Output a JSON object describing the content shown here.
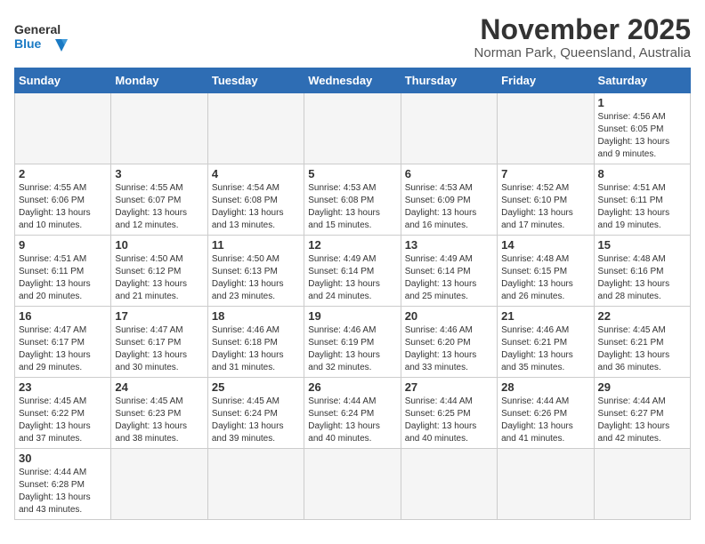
{
  "header": {
    "title": "November 2025",
    "subtitle": "Norman Park, Queensland, Australia",
    "logo_general": "General",
    "logo_blue": "Blue"
  },
  "days_of_week": [
    "Sunday",
    "Monday",
    "Tuesday",
    "Wednesday",
    "Thursday",
    "Friday",
    "Saturday"
  ],
  "weeks": [
    [
      {
        "day": "",
        "info": ""
      },
      {
        "day": "",
        "info": ""
      },
      {
        "day": "",
        "info": ""
      },
      {
        "day": "",
        "info": ""
      },
      {
        "day": "",
        "info": ""
      },
      {
        "day": "",
        "info": ""
      },
      {
        "day": "1",
        "info": "Sunrise: 4:56 AM\nSunset: 6:05 PM\nDaylight: 13 hours and 9 minutes."
      }
    ],
    [
      {
        "day": "2",
        "info": "Sunrise: 4:55 AM\nSunset: 6:06 PM\nDaylight: 13 hours and 10 minutes."
      },
      {
        "day": "3",
        "info": "Sunrise: 4:55 AM\nSunset: 6:07 PM\nDaylight: 13 hours and 12 minutes."
      },
      {
        "day": "4",
        "info": "Sunrise: 4:54 AM\nSunset: 6:08 PM\nDaylight: 13 hours and 13 minutes."
      },
      {
        "day": "5",
        "info": "Sunrise: 4:53 AM\nSunset: 6:08 PM\nDaylight: 13 hours and 15 minutes."
      },
      {
        "day": "6",
        "info": "Sunrise: 4:53 AM\nSunset: 6:09 PM\nDaylight: 13 hours and 16 minutes."
      },
      {
        "day": "7",
        "info": "Sunrise: 4:52 AM\nSunset: 6:10 PM\nDaylight: 13 hours and 17 minutes."
      },
      {
        "day": "8",
        "info": "Sunrise: 4:51 AM\nSunset: 6:11 PM\nDaylight: 13 hours and 19 minutes."
      }
    ],
    [
      {
        "day": "9",
        "info": "Sunrise: 4:51 AM\nSunset: 6:11 PM\nDaylight: 13 hours and 20 minutes."
      },
      {
        "day": "10",
        "info": "Sunrise: 4:50 AM\nSunset: 6:12 PM\nDaylight: 13 hours and 21 minutes."
      },
      {
        "day": "11",
        "info": "Sunrise: 4:50 AM\nSunset: 6:13 PM\nDaylight: 13 hours and 23 minutes."
      },
      {
        "day": "12",
        "info": "Sunrise: 4:49 AM\nSunset: 6:14 PM\nDaylight: 13 hours and 24 minutes."
      },
      {
        "day": "13",
        "info": "Sunrise: 4:49 AM\nSunset: 6:14 PM\nDaylight: 13 hours and 25 minutes."
      },
      {
        "day": "14",
        "info": "Sunrise: 4:48 AM\nSunset: 6:15 PM\nDaylight: 13 hours and 26 minutes."
      },
      {
        "day": "15",
        "info": "Sunrise: 4:48 AM\nSunset: 6:16 PM\nDaylight: 13 hours and 28 minutes."
      }
    ],
    [
      {
        "day": "16",
        "info": "Sunrise: 4:47 AM\nSunset: 6:17 PM\nDaylight: 13 hours and 29 minutes."
      },
      {
        "day": "17",
        "info": "Sunrise: 4:47 AM\nSunset: 6:17 PM\nDaylight: 13 hours and 30 minutes."
      },
      {
        "day": "18",
        "info": "Sunrise: 4:46 AM\nSunset: 6:18 PM\nDaylight: 13 hours and 31 minutes."
      },
      {
        "day": "19",
        "info": "Sunrise: 4:46 AM\nSunset: 6:19 PM\nDaylight: 13 hours and 32 minutes."
      },
      {
        "day": "20",
        "info": "Sunrise: 4:46 AM\nSunset: 6:20 PM\nDaylight: 13 hours and 33 minutes."
      },
      {
        "day": "21",
        "info": "Sunrise: 4:46 AM\nSunset: 6:21 PM\nDaylight: 13 hours and 35 minutes."
      },
      {
        "day": "22",
        "info": "Sunrise: 4:45 AM\nSunset: 6:21 PM\nDaylight: 13 hours and 36 minutes."
      }
    ],
    [
      {
        "day": "23",
        "info": "Sunrise: 4:45 AM\nSunset: 6:22 PM\nDaylight: 13 hours and 37 minutes."
      },
      {
        "day": "24",
        "info": "Sunrise: 4:45 AM\nSunset: 6:23 PM\nDaylight: 13 hours and 38 minutes."
      },
      {
        "day": "25",
        "info": "Sunrise: 4:45 AM\nSunset: 6:24 PM\nDaylight: 13 hours and 39 minutes."
      },
      {
        "day": "26",
        "info": "Sunrise: 4:44 AM\nSunset: 6:24 PM\nDaylight: 13 hours and 40 minutes."
      },
      {
        "day": "27",
        "info": "Sunrise: 4:44 AM\nSunset: 6:25 PM\nDaylight: 13 hours and 40 minutes."
      },
      {
        "day": "28",
        "info": "Sunrise: 4:44 AM\nSunset: 6:26 PM\nDaylight: 13 hours and 41 minutes."
      },
      {
        "day": "29",
        "info": "Sunrise: 4:44 AM\nSunset: 6:27 PM\nDaylight: 13 hours and 42 minutes."
      }
    ],
    [
      {
        "day": "30",
        "info": "Sunrise: 4:44 AM\nSunset: 6:28 PM\nDaylight: 13 hours and 43 minutes."
      },
      {
        "day": "",
        "info": ""
      },
      {
        "day": "",
        "info": ""
      },
      {
        "day": "",
        "info": ""
      },
      {
        "day": "",
        "info": ""
      },
      {
        "day": "",
        "info": ""
      },
      {
        "day": "",
        "info": ""
      }
    ]
  ]
}
